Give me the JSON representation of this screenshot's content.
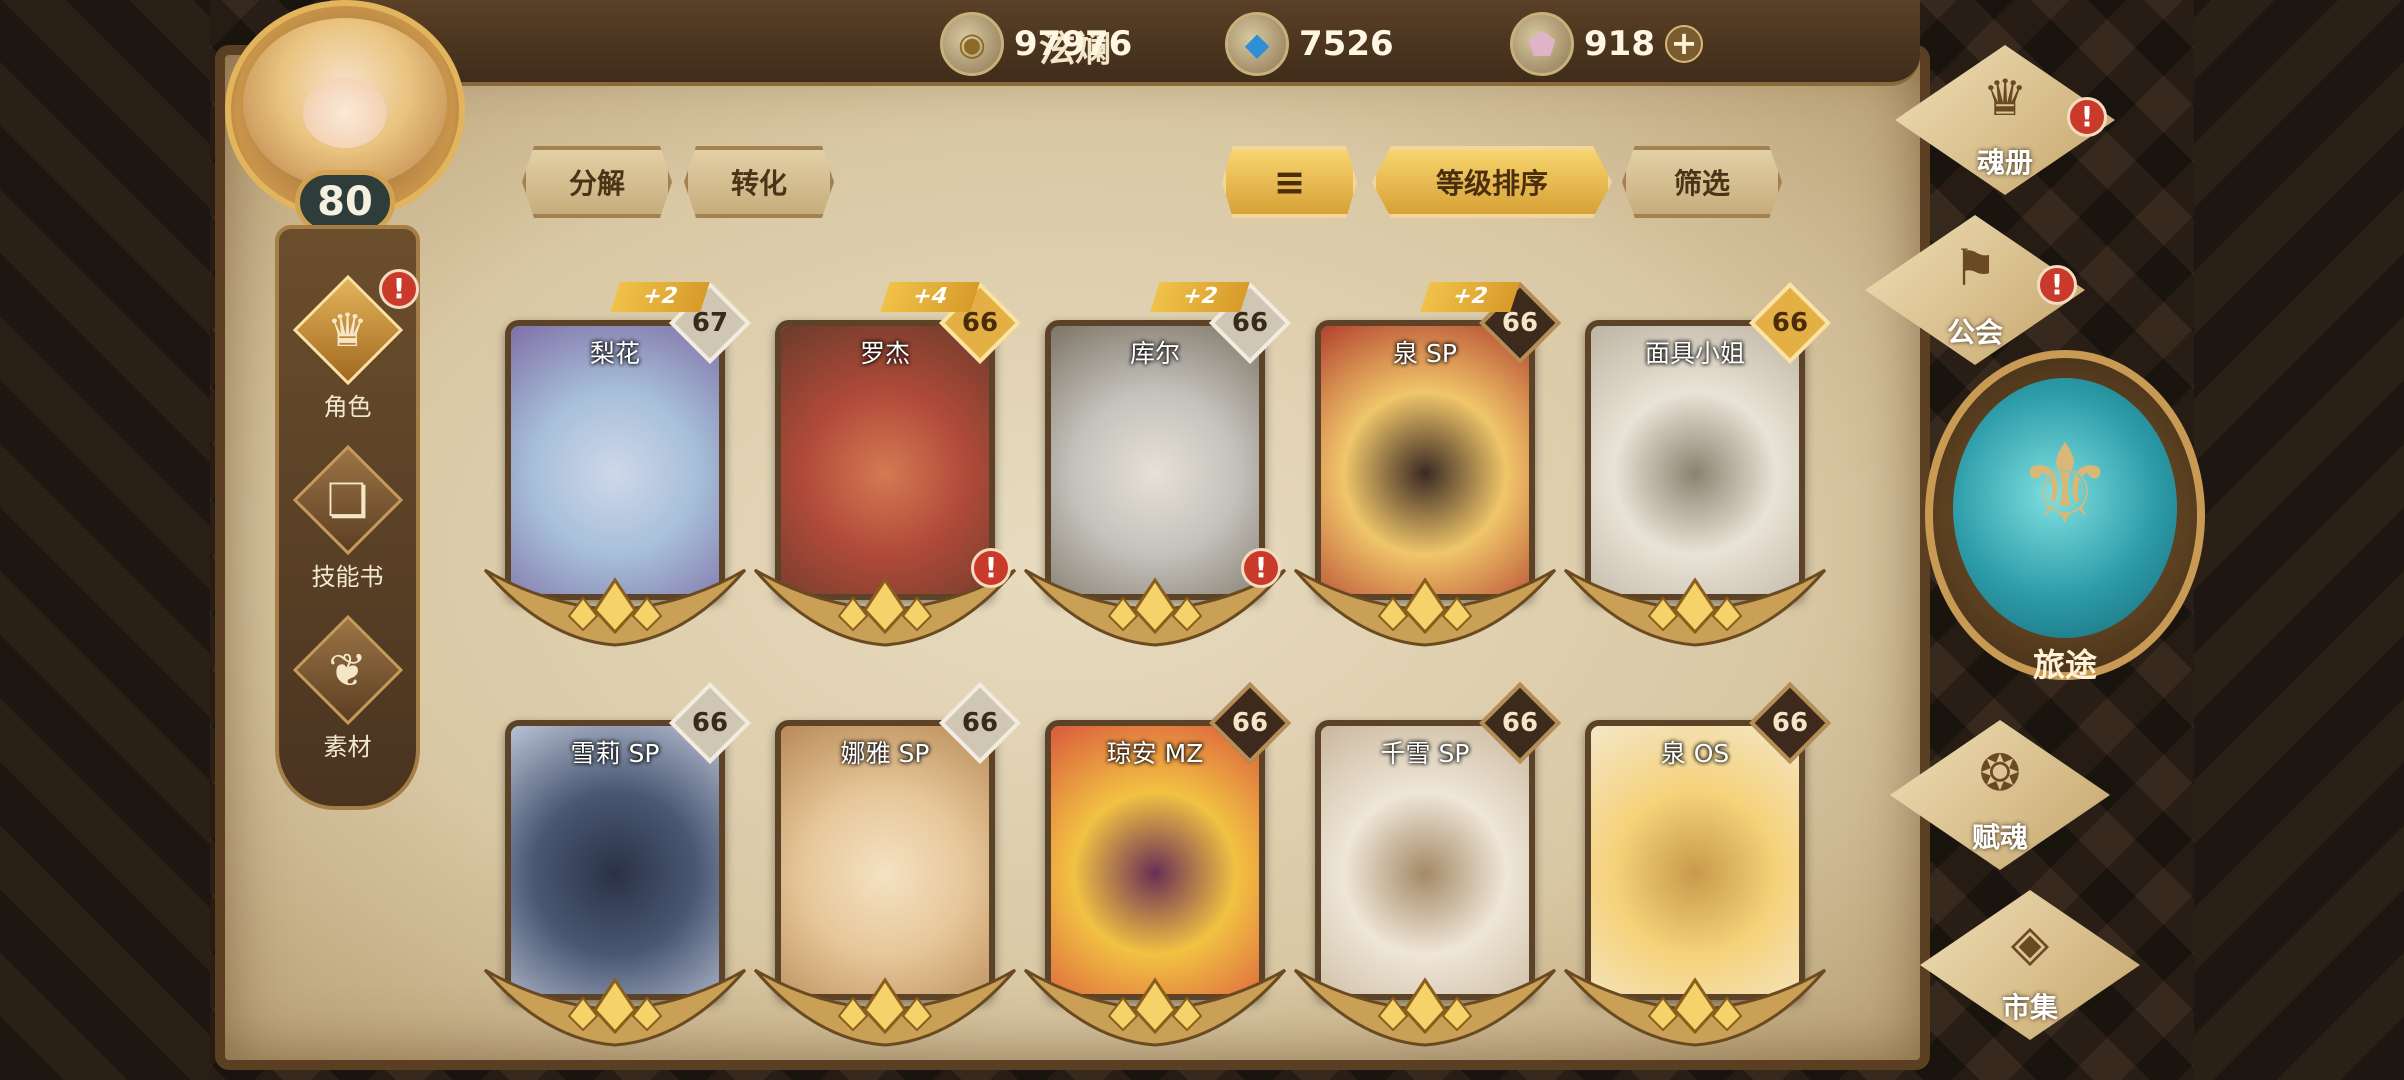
{
  "player": {
    "name": "泫斓",
    "level": "80"
  },
  "currencies": [
    {
      "name": "gold-coin-icon",
      "glyph": "◉",
      "value": "97976"
    },
    {
      "name": "blue-crystal-icon",
      "glyph": "◆",
      "value": "7526"
    },
    {
      "name": "pink-gem-icon",
      "glyph": "⬟",
      "value": "918"
    }
  ],
  "plus_label": "+",
  "left_nav": [
    {
      "label": "角色",
      "icon": "♛",
      "active": true,
      "alert": true
    },
    {
      "label": "技能书",
      "icon": "❏",
      "active": false,
      "alert": false
    },
    {
      "label": "素材",
      "icon": "❦",
      "active": false,
      "alert": false
    }
  ],
  "toolbar": {
    "decompose": "分解",
    "convert": "转化",
    "sort_icon": "≡",
    "sort_by_level": "等级排序",
    "filter": "筛选"
  },
  "alert_glyph": "!",
  "cards": [
    {
      "name": "梨花",
      "level": "67",
      "plus": "+2",
      "badge": "light",
      "alert": false
    },
    {
      "name": "罗杰",
      "level": "66",
      "plus": "+4",
      "badge": "gold",
      "alert": true
    },
    {
      "name": "库尔",
      "level": "66",
      "plus": "+2",
      "badge": "light",
      "alert": true
    },
    {
      "name": "泉 SP",
      "level": "66",
      "plus": "+2",
      "badge": "dark",
      "alert": false
    },
    {
      "name": "面具小姐",
      "level": "66",
      "plus": "",
      "badge": "gold",
      "alert": false
    },
    {
      "name": "雪莉 SP",
      "level": "66",
      "plus": "",
      "badge": "light",
      "alert": false
    },
    {
      "name": "娜雅 SP",
      "level": "66",
      "plus": "",
      "badge": "light",
      "alert": false
    },
    {
      "name": "琼安 MZ",
      "level": "66",
      "plus": "",
      "badge": "dark",
      "alert": false
    },
    {
      "name": "千雪 SP",
      "level": "66",
      "plus": "",
      "badge": "dark",
      "alert": false
    },
    {
      "name": "泉 OS",
      "level": "66",
      "plus": "",
      "badge": "dark",
      "alert": false
    }
  ],
  "right_nav": {
    "soul_book": {
      "label": "魂册",
      "icon": "♛"
    },
    "guild": {
      "label": "公会",
      "icon": "⚑"
    },
    "journey": {
      "label": "旅途",
      "icon": "⚜"
    },
    "endow_soul": {
      "label": "赋魂",
      "icon": "❂"
    },
    "market": {
      "label": "市集",
      "icon": "◈"
    }
  },
  "colors": {
    "accent_gold": "#e4b045",
    "alert_red": "#c93a2a",
    "parchment": "#e0d2b2"
  }
}
